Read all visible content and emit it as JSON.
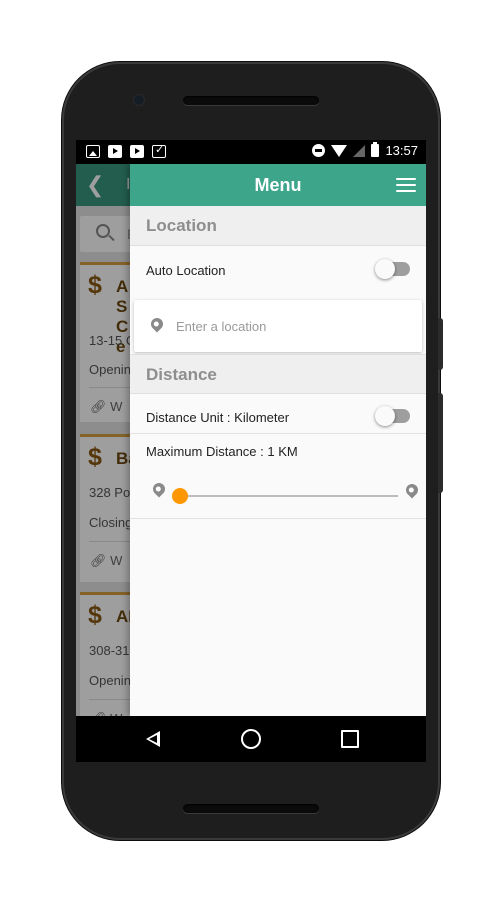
{
  "status_bar": {
    "time": "13:57",
    "left_icons": [
      "image-notification-icon",
      "youtube-notification-icon",
      "youtube-notification-icon",
      "clipboard-check-notification-icon"
    ],
    "right_icons": [
      "do-not-disturb-icon",
      "wifi-icon",
      "signal-icon",
      "battery-icon"
    ]
  },
  "background_screen": {
    "back_icon": "chevron-left-icon",
    "title_partial": "I",
    "search_placeholder_partial": "E",
    "cards": [
      {
        "name": "AS Ce",
        "address": "13-15 C",
        "status": "Openin",
        "link": "W"
      },
      {
        "name": "Ba",
        "address": "328 Po",
        "status": "Closing",
        "link": "W"
      },
      {
        "name": "AN",
        "address": "308-31",
        "status": "Openin",
        "link": "W"
      }
    ],
    "card_symbol": "$"
  },
  "drawer": {
    "title": "Menu",
    "menu_icon": "hamburger-menu-icon",
    "location_section": {
      "header": "Location",
      "auto_location_label": "Auto Location",
      "auto_location_enabled": false,
      "location_placeholder": "Enter a location",
      "location_value": ""
    },
    "distance_section": {
      "header": "Distance",
      "unit_label": "Distance Unit : Kilometer",
      "unit_toggle_enabled": false,
      "max_distance_label": "Maximum Distance : 1 KM",
      "slider_value_fraction": 0.0
    }
  },
  "nav_bar": {
    "icons": [
      "back-triangle-icon",
      "home-circle-icon",
      "recent-apps-square-icon"
    ]
  },
  "colors": {
    "toolbar_teal": "#3da58a",
    "accent_orange": "#ff9800",
    "card_border_gold": "#d7a142",
    "section_header_text": "#8e8e8e"
  }
}
